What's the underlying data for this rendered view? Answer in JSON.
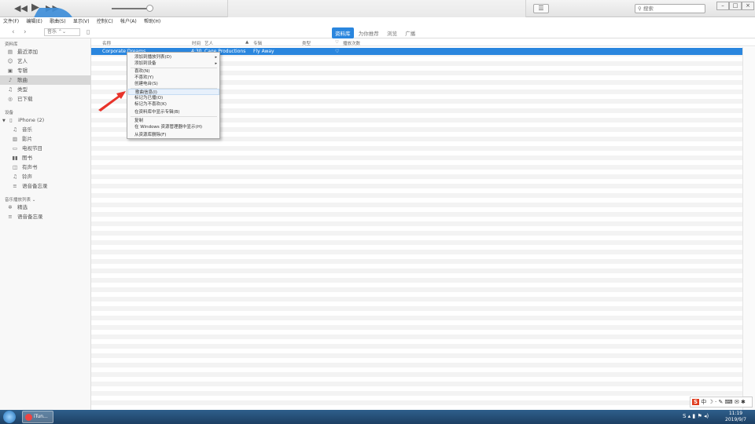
{
  "menubar": [
    "文件(F)",
    "编辑(E)",
    "歌曲(S)",
    "显示(V)",
    "控制(C)",
    "帐户(A)",
    "帮助(H)"
  ],
  "nav": {
    "dropdown": "音乐"
  },
  "tabs": [
    "资料库",
    "为你推荐",
    "浏览",
    "广播"
  ],
  "search": {
    "placeholder": "搜索"
  },
  "sidebar": {
    "library_title": "资料库",
    "library_items": [
      {
        "label": "最近添加",
        "icon": "recent-icon"
      },
      {
        "label": "艺人",
        "icon": "artist-icon"
      },
      {
        "label": "专辑",
        "icon": "album-icon"
      },
      {
        "label": "歌曲",
        "icon": "note-icon"
      },
      {
        "label": "类型",
        "icon": "genre-icon"
      },
      {
        "label": "已下载",
        "icon": "download-icon"
      }
    ],
    "devices_title": "设备",
    "device": "iPhone (2)",
    "device_items": [
      {
        "label": "音乐",
        "icon": "note-icon"
      },
      {
        "label": "影片",
        "icon": "film-icon"
      },
      {
        "label": "电视节目",
        "icon": "tv-icon"
      },
      {
        "label": "图书",
        "icon": "book-icon"
      },
      {
        "label": "有声书",
        "icon": "audiobook-icon"
      },
      {
        "label": "铃声",
        "icon": "bell-icon"
      },
      {
        "label": "语音备忘录",
        "icon": "voice-memo-icon"
      }
    ],
    "playlists_title": "音乐播放列表 ⌄",
    "playlist_items": [
      {
        "label": "精选",
        "icon": "genius-icon"
      },
      {
        "label": "语音备忘录",
        "icon": "voice-memo-icon"
      }
    ]
  },
  "columns": {
    "name": "名称",
    "time": "时间",
    "artist": "艺人",
    "album": "专辑",
    "genre": "类型",
    "plays": "播放次数"
  },
  "row": {
    "name": "Corporate Dreams",
    "time": "4:30",
    "artist": "Cage Productions",
    "album": "Fly Away",
    "love": "♡"
  },
  "context_menu": [
    {
      "label": "添加到播放列表(D)",
      "sub": true
    },
    {
      "label": "添加到设备",
      "sub": true
    },
    {
      "label": "喜欢(N)"
    },
    {
      "label": "不喜欢(Y)"
    },
    {
      "label": "创建电台(S)"
    },
    {
      "label": "歌曲信息(I)",
      "highlight": true
    },
    {
      "label": "标记为已播(O)"
    },
    {
      "label": "标记为不喜欢(K)"
    },
    {
      "label": "在资料库中显示专辑(B)"
    },
    {
      "label": "复制"
    },
    {
      "label": "在 Windows 资源管理器中显示(H)"
    },
    {
      "label": "从资源库删除(F)"
    }
  ],
  "watermark": "虎观",
  "taskbar": {
    "app": "iTun...",
    "time": "11:19",
    "date": "2019/9/7",
    "ime": "中"
  },
  "colors": {
    "accent": "#2a86de",
    "arrow": "#e8332a"
  }
}
